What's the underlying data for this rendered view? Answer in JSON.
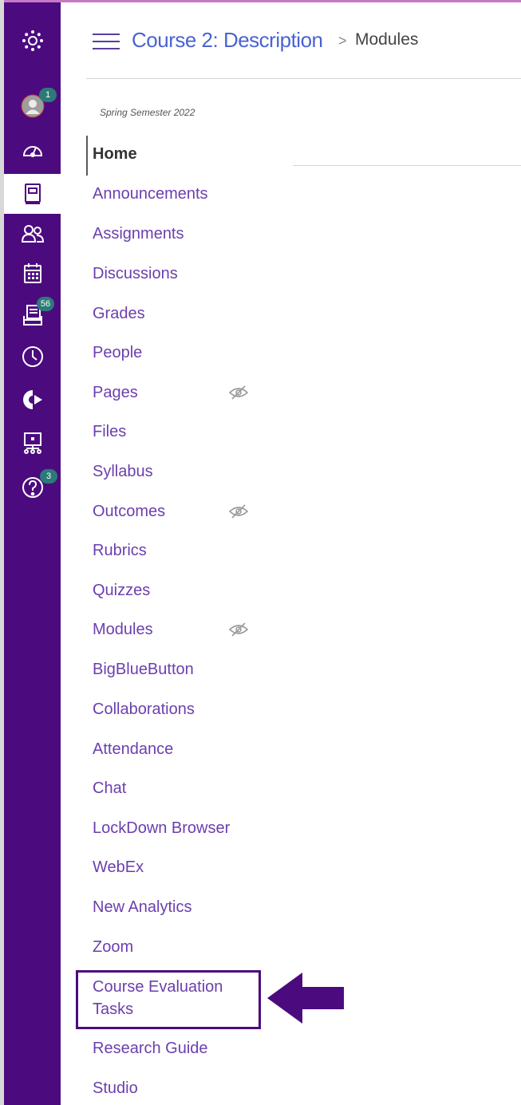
{
  "header": {
    "course_title": "Course 2: Description",
    "breadcrumb_separator": ">",
    "breadcrumb_current": "Modules"
  },
  "global_nav": {
    "items": [
      {
        "icon": "canvas-logo-icon"
      },
      {
        "icon": "account-avatar-icon",
        "badge": "1"
      },
      {
        "icon": "dashboard-icon"
      },
      {
        "icon": "courses-icon"
      },
      {
        "icon": "groups-icon"
      },
      {
        "icon": "calendar-icon"
      },
      {
        "icon": "inbox-icon",
        "badge": "56"
      },
      {
        "icon": "history-icon"
      },
      {
        "icon": "commons-icon"
      },
      {
        "icon": "studio-icon"
      },
      {
        "icon": "help-icon",
        "badge": "3"
      }
    ],
    "colors": {
      "background": "#4b0b7f",
      "badge": "#2b7a78"
    }
  },
  "course_nav": {
    "term": "Spring Semester 2022",
    "items": [
      {
        "label": "Home"
      },
      {
        "label": "Announcements"
      },
      {
        "label": "Assignments"
      },
      {
        "label": "Discussions"
      },
      {
        "label": "Grades"
      },
      {
        "label": "People"
      },
      {
        "label": "Pages",
        "icon": "hidden-eye-icon"
      },
      {
        "label": "Files"
      },
      {
        "label": "Syllabus"
      },
      {
        "label": "Outcomes",
        "icon": "hidden-eye-icon"
      },
      {
        "label": "Rubrics"
      },
      {
        "label": "Quizzes"
      },
      {
        "label": "Modules",
        "icon": "hidden-eye-icon"
      },
      {
        "label": "BigBlueButton"
      },
      {
        "label": "Collaborations"
      },
      {
        "label": "Attendance"
      },
      {
        "label": "Chat"
      },
      {
        "label": "LockDown Browser"
      },
      {
        "label": "WebEx"
      },
      {
        "label": "New Analytics"
      },
      {
        "label": "Zoom"
      },
      {
        "label": "Course Evaluation Tasks"
      },
      {
        "label": "Research Guide"
      },
      {
        "label": "Studio"
      }
    ],
    "colors": {
      "link": "#6b3fae",
      "active": "#333333"
    }
  },
  "annotation": {
    "icon": "left-arrow-icon",
    "color": "#4b0b7f"
  }
}
